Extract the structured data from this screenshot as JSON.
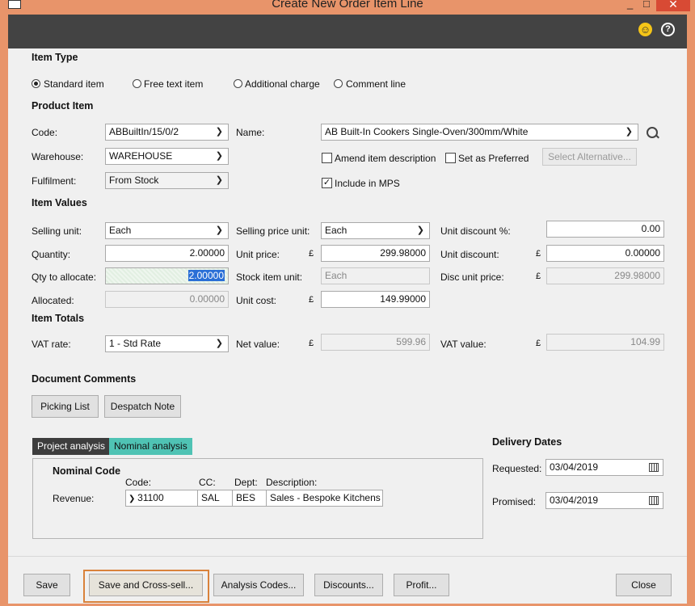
{
  "window": {
    "title": "Create New Order Item Line",
    "min": "_",
    "max": "□",
    "close": "✕"
  },
  "sections": {
    "item_type": "Item Type",
    "product_item": "Product Item",
    "item_values": "Item Values",
    "item_totals": "Item Totals",
    "document_comments": "Document Comments",
    "delivery_dates": "Delivery Dates"
  },
  "item_type": {
    "options": [
      "Standard item",
      "Free text item",
      "Additional charge",
      "Comment line"
    ],
    "selected": "Standard item"
  },
  "product": {
    "code_label": "Code:",
    "code": "ABBuiltIn/15/0/2",
    "name_label": "Name:",
    "name": "AB Built-In Cookers Single-Oven/300mm/White",
    "warehouse_label": "Warehouse:",
    "warehouse": "WAREHOUSE",
    "fulfilment_label": "Fulfilment:",
    "fulfilment": "From Stock",
    "amend_label": "Amend item description",
    "preferred_label": "Set as Preferred",
    "alternative_label": "Select Alternative...",
    "mps_label": "Include in MPS",
    "mps_checked": "✓"
  },
  "values": {
    "selling_unit_label": "Selling unit:",
    "selling_unit": "Each",
    "selling_price_unit_label": "Selling price unit:",
    "selling_price_unit": "Each",
    "unit_discount_pct_label": "Unit discount %:",
    "unit_discount_pct": "0.00",
    "quantity_label": "Quantity:",
    "quantity": "2.00000",
    "unit_price_label": "Unit price:",
    "unit_price": "299.98000",
    "unit_discount_label": "Unit discount:",
    "unit_discount": "0.00000",
    "qty_allocate_label": "Qty to allocate:",
    "qty_allocate": "2.00000",
    "stock_item_unit_label": "Stock item unit:",
    "stock_item_unit": "Each",
    "disc_unit_price_label": "Disc unit price:",
    "disc_unit_price": "299.98000",
    "allocated_label": "Allocated:",
    "allocated": "0.00000",
    "unit_cost_label": "Unit cost:",
    "unit_cost": "149.99000",
    "currency": "£"
  },
  "totals": {
    "vat_rate_label": "VAT rate:",
    "vat_rate": "1 - Std Rate",
    "net_value_label": "Net value:",
    "net_value": "599.96",
    "vat_value_label": "VAT value:",
    "vat_value": "104.99"
  },
  "comments": {
    "picking": "Picking List",
    "despatch": "Despatch Note"
  },
  "analysis": {
    "tabs": [
      "Project analysis",
      "Nominal analysis"
    ],
    "nominal_code": "Nominal Code",
    "code_hdr": "Code:",
    "cc_hdr": "CC:",
    "dept_hdr": "Dept:",
    "desc_hdr": "Description:",
    "revenue_label": "Revenue:",
    "code": "31100",
    "cc": "SAL",
    "dept": "BES",
    "description": "Sales - Bespoke Kitchens"
  },
  "delivery": {
    "requested_label": "Requested:",
    "requested": "03/04/2019",
    "promised_label": "Promised:",
    "promised": "03/04/2019"
  },
  "footer": {
    "save": "Save",
    "save_cross": "Save and Cross-sell...",
    "analysis_codes": "Analysis Codes...",
    "discounts": "Discounts...",
    "profit": "Profit...",
    "close": "Close"
  },
  "colors": {
    "accent_tab": "#4fc3b4",
    "dark_tab": "#3d3d3d",
    "focus_border": "#d9823b"
  }
}
